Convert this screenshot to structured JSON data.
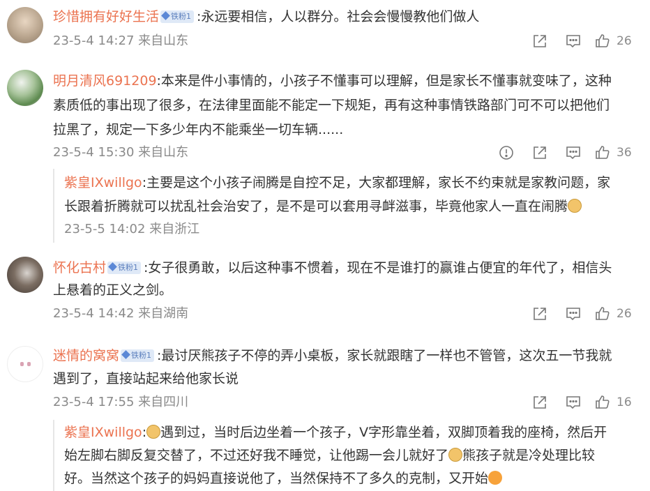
{
  "comments": [
    {
      "user": "珍惜拥有好好生活",
      "badge": "铁粉1",
      "lines": [
        ":永远要相信，人以群分。社会会慢慢教他们做人"
      ],
      "date": "23-5-4 14:27",
      "loc": "来自山东",
      "likes": "26"
    },
    {
      "user": "明月清风691209",
      "lines": [
        ":本来是件小事情的，小孩子不懂事可以理解，但是家长不懂事就变味了，这种",
        "素质低的事出现了很多，在法律里面能不能定一下规矩，再有这种事情铁路部门可不可以把他们",
        "拉黑了，规定一下多少年内不能乘坐一切车辆......"
      ],
      "date": "23-5-4 15:30",
      "loc": "来自山东",
      "likes": "36",
      "reply": {
        "user": "紫皇IXwillgo",
        "lines": [
          ":主要是这个小孩子闹腾是自控不足，大家都理解，家长不约束就是家教问题，家",
          "长跟着折腾就可以扰乱社会治安了，是不是可以套用寻衅滋事，毕竟他家人一直在闹腾"
        ],
        "date": "23-5-5 14:02",
        "loc": "来自浙江"
      }
    },
    {
      "user": "怀化古村",
      "badge": "铁粉1",
      "lines": [
        ":女子很勇敢，以后这种事不惯着，现在不是谁打的赢谁占便宜的年代了，相信头",
        "上悬着的正义之剑。"
      ],
      "date": "23-5-4 14:42",
      "loc": "来自湖南",
      "likes": "26"
    },
    {
      "user": "迷情的窝窝",
      "badge": "铁粉1",
      "lines": [
        ":最讨厌熊孩子不停的弄小桌板，家长就跟瞎了一样也不管管，这次五一节我就",
        "遇到了，直接站起来给他家长说"
      ],
      "date": "23-5-4 17:55",
      "loc": "来自四川",
      "likes": "16",
      "reply": {
        "user": "紫皇IXwillgo",
        "lines": [
          ":",
          "遇到过，当时后边坐着一个孩子，V字形靠坐着，双脚顶着我的座椅，然后开",
          "始左脚右脚反复交替了，不过还好我不睡觉，让他踢一会儿就好了",
          "熊孩子就是冷处理比较",
          "好。当然这个孩子的妈妈直接说他了，当然保持不了多久的克制，又开始"
        ]
      }
    }
  ]
}
